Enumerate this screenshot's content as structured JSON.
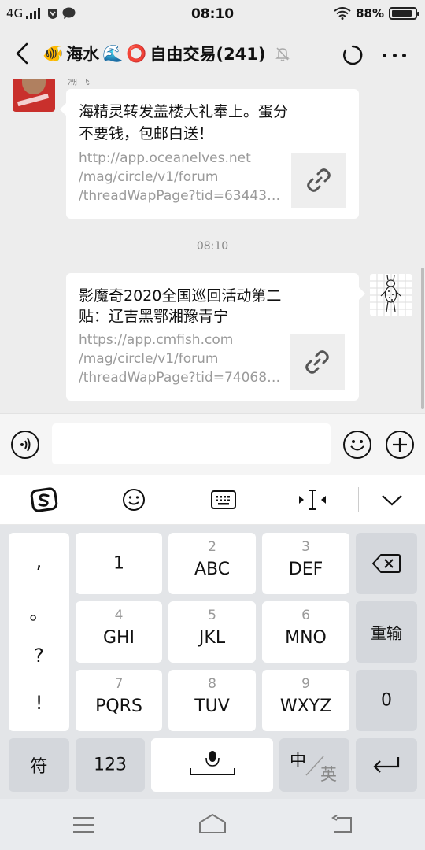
{
  "status_bar": {
    "network": "4G",
    "time": "08:10",
    "battery_text": "88%",
    "battery_level": 0.88
  },
  "header": {
    "title_emoji_1": "🐠",
    "title_part_1": "海水",
    "title_emoji_2": "🌊",
    "title_emoji_3": "⭕",
    "title_part_2": "自由交易(241)"
  },
  "chat": {
    "partial_nick": "潮 飞",
    "messages": [
      {
        "title_line1": "海精灵转发盖楼大礼奉上。蛋分",
        "title_line2": "不要钱，包邮白送！",
        "url_line1": "http://app.oceanelves.net",
        "url_line2": "/mag/circle/v1/forum",
        "url_line3": "/threadWapPage?tid=63443…"
      },
      {
        "title_line1": "影魔奇2020全国巡回活动第二",
        "title_line2": "贴：辽吉黑鄂湘豫青宁",
        "url_line1": "https://app.cmfish.com",
        "url_line2": "/mag/circle/v1/forum",
        "url_line3": "/threadWapPage?tid=74068…"
      }
    ],
    "timestamp": "08:10"
  },
  "input": {
    "placeholder": ""
  },
  "keyboard": {
    "punct": [
      ",",
      "。",
      "?",
      "!"
    ],
    "row1": [
      {
        "sub": "",
        "main": "1"
      },
      {
        "sub": "2",
        "main": "ABC"
      },
      {
        "sub": "3",
        "main": "DEF"
      }
    ],
    "row2": [
      {
        "sub": "4",
        "main": "GHI"
      },
      {
        "sub": "5",
        "main": "JKL"
      },
      {
        "sub": "6",
        "main": "MNO"
      }
    ],
    "row3": [
      {
        "sub": "7",
        "main": "PQRS"
      },
      {
        "sub": "8",
        "main": "TUV"
      },
      {
        "sub": "9",
        "main": "WXYZ"
      }
    ],
    "reenter": "重输",
    "zero": "0",
    "symbols": "符",
    "num_switch": "123",
    "lang_cn": "中",
    "lang_en": "英"
  }
}
